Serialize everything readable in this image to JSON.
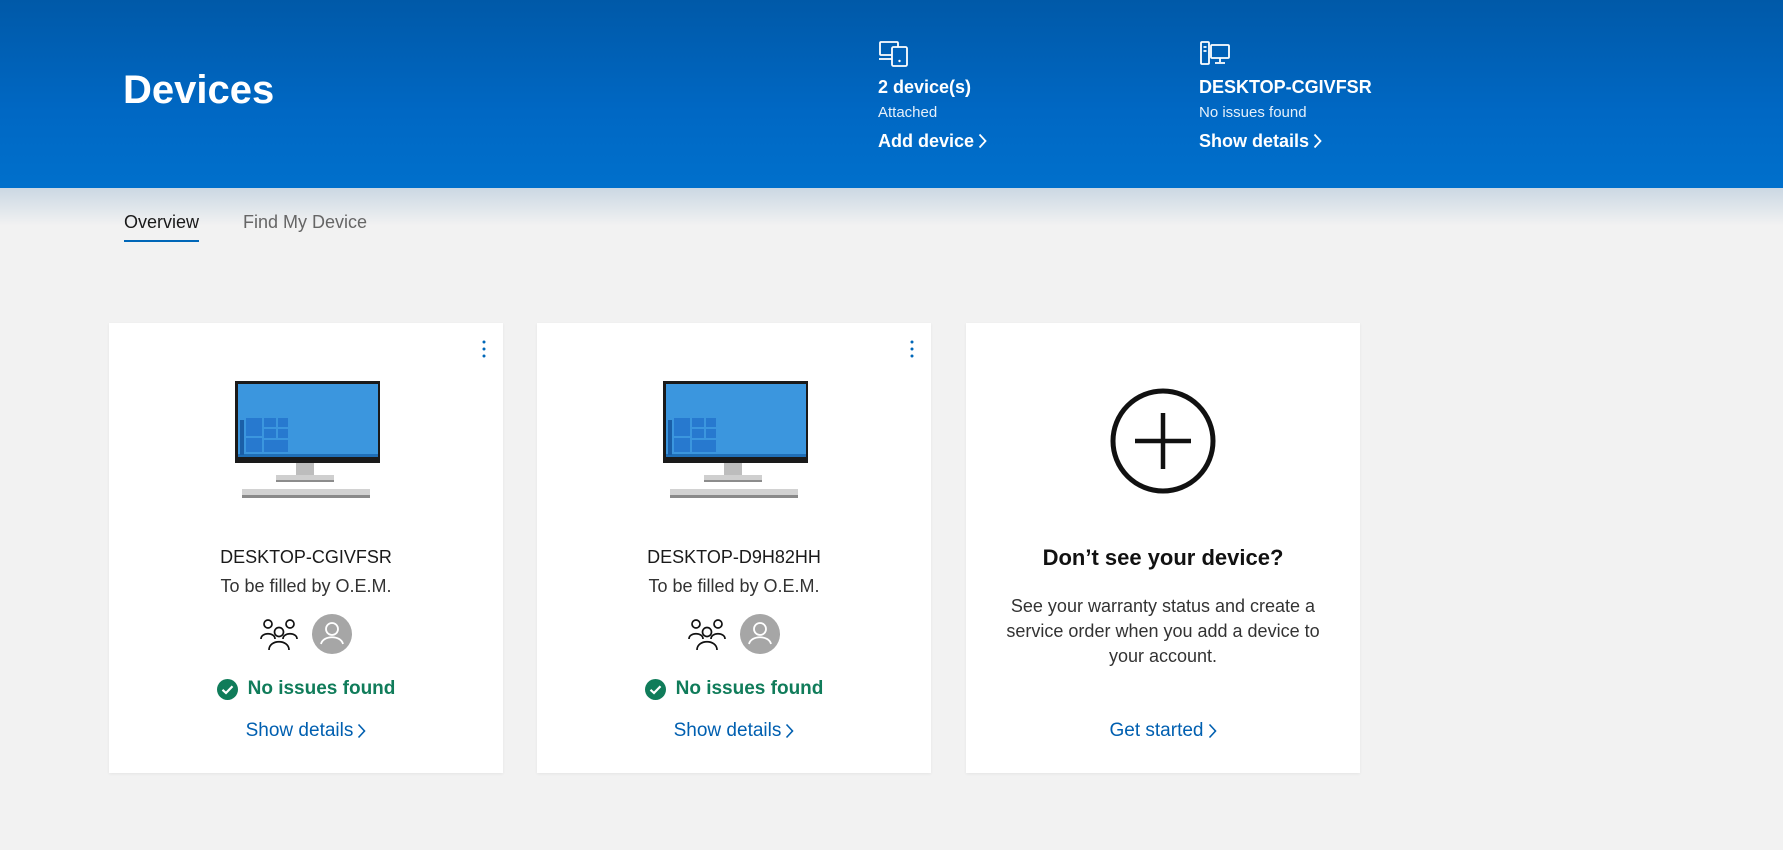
{
  "header": {
    "title": "Devices",
    "devices_summary": {
      "icon": "devices-icon",
      "title": "2 device(s)",
      "subtitle": "Attached",
      "link": "Add device"
    },
    "current_device": {
      "icon": "desktop-icon",
      "title": "DESKTOP-CGIVFSR",
      "subtitle": "No issues found",
      "link": "Show details"
    }
  },
  "tabs": [
    {
      "label": "Overview",
      "active": true
    },
    {
      "label": "Find My Device",
      "active": false
    }
  ],
  "cards": [
    {
      "name": "DESKTOP-CGIVFSR",
      "subtitle": "To be filled by O.E.M.",
      "status": "No issues found",
      "link": "Show details"
    },
    {
      "name": "DESKTOP-D9H82HH",
      "subtitle": "To be filled by O.E.M.",
      "status": "No issues found",
      "link": "Show details"
    }
  ],
  "add_card": {
    "title": "Don’t see your device?",
    "description": "See your warranty status and create a service order when you add a device to your account.",
    "link": "Get started"
  },
  "colors": {
    "header_blue": "#0068c4",
    "link_blue": "#005fb0",
    "status_green": "#107c5a",
    "background": "#f2f2f2"
  }
}
